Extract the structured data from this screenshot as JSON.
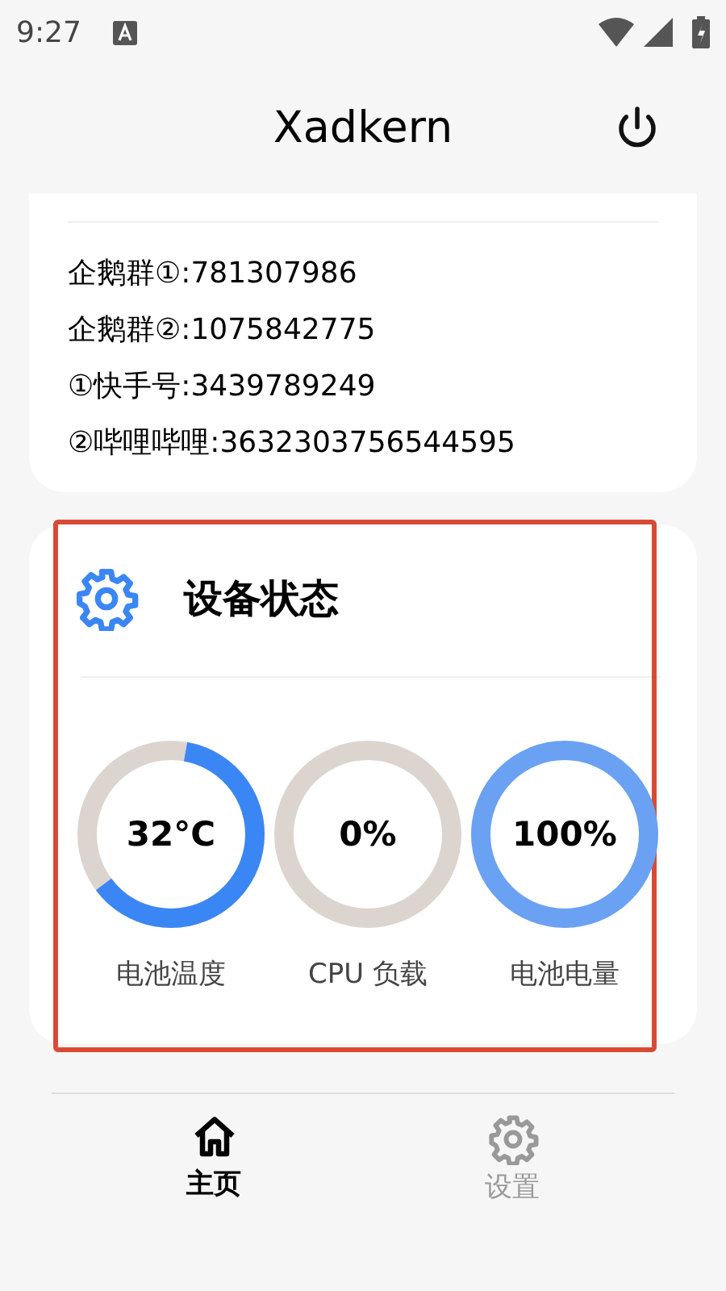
{
  "status_bar": {
    "time": "9:27"
  },
  "header": {
    "title": "Xadkern"
  },
  "contact_card": {
    "lines": [
      "企鹅群①:781307986",
      "企鹅群②:1075842775",
      "①快手号:3439789249",
      "②哔哩哔哩:3632303756544595"
    ]
  },
  "status_card": {
    "title": "设备状态",
    "highlighted": true,
    "gauges": [
      {
        "value": "32°C",
        "label": "电池温度",
        "kind": "arc",
        "color": "#3b86f5"
      },
      {
        "value": "0%",
        "label": "CPU 负载",
        "kind": "track"
      },
      {
        "value": "100%",
        "label": "电池电量",
        "kind": "ring",
        "color": "#6aa1f2"
      }
    ]
  },
  "bottom_nav": [
    {
      "label": "主页",
      "selected": true
    },
    {
      "label": "设置",
      "selected": false
    }
  ]
}
